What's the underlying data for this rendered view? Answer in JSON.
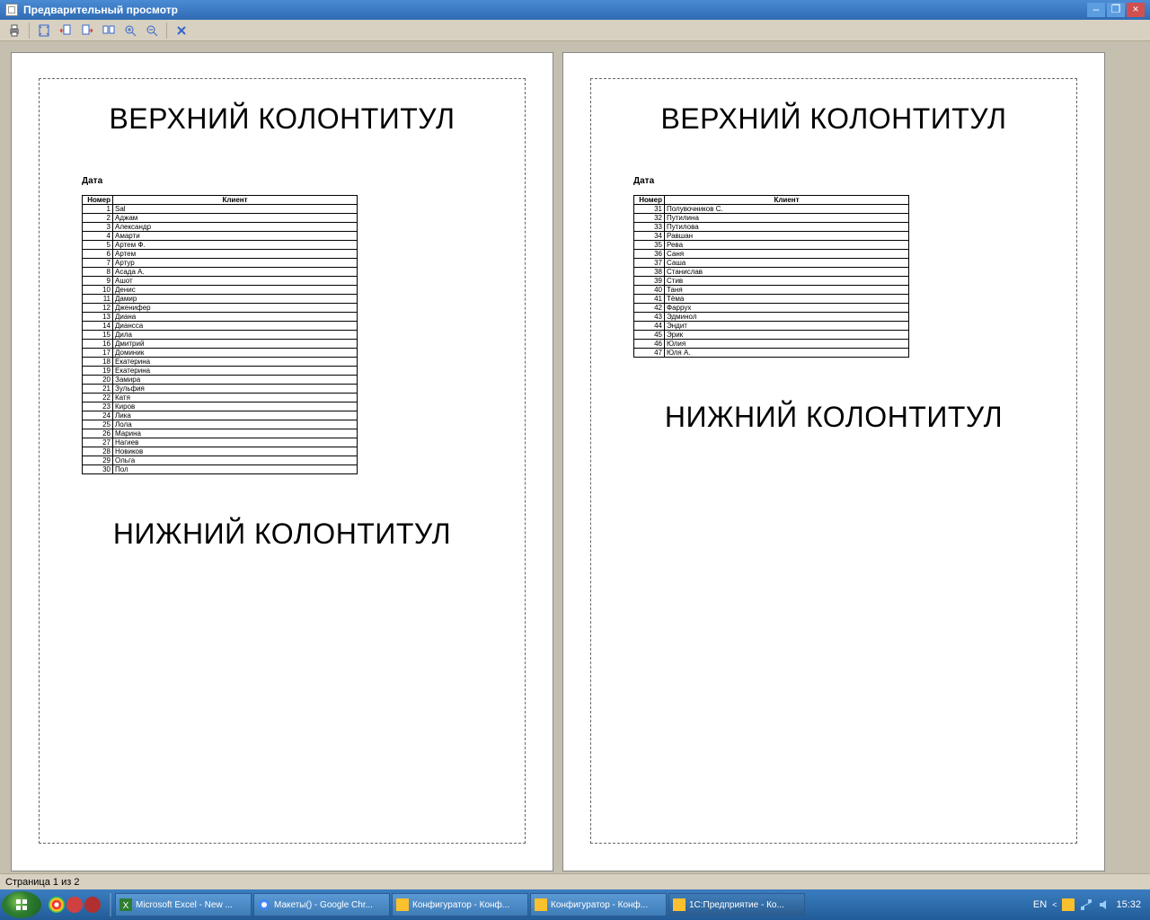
{
  "window_title": "Предварительный просмотр",
  "header_text": "ВЕРХНИЙ КОЛОНТИТУЛ",
  "footer_text": "НИЖНИЙ КОЛОНТИТУЛ",
  "date_label": "Дата",
  "table_headers": {
    "num": "Номер",
    "client": "Клиент"
  },
  "page1_rows": [
    [
      1,
      "Sal"
    ],
    [
      2,
      "Аджам"
    ],
    [
      3,
      "Александр"
    ],
    [
      4,
      "Амарти"
    ],
    [
      5,
      "Артем Ф."
    ],
    [
      6,
      "Артем"
    ],
    [
      7,
      "Артур"
    ],
    [
      8,
      "Асада А."
    ],
    [
      9,
      "Ашот"
    ],
    [
      10,
      "Денис"
    ],
    [
      11,
      "Дамир"
    ],
    [
      12,
      "Дженифер"
    ],
    [
      13,
      "Диана"
    ],
    [
      14,
      "Диансса"
    ],
    [
      15,
      "Дила"
    ],
    [
      16,
      "Дмитрий"
    ],
    [
      17,
      "Доминик"
    ],
    [
      18,
      "Екатерина"
    ],
    [
      19,
      "Екатерина"
    ],
    [
      20,
      "Замира"
    ],
    [
      21,
      "Зульфия"
    ],
    [
      22,
      "Катя"
    ],
    [
      23,
      "Киров"
    ],
    [
      24,
      "Лика"
    ],
    [
      25,
      "Лола"
    ],
    [
      26,
      "Марина"
    ],
    [
      27,
      "Нагиев"
    ],
    [
      28,
      "Новиков"
    ],
    [
      29,
      "Ольга"
    ],
    [
      30,
      "Пол"
    ]
  ],
  "page2_rows": [
    [
      31,
      "Полувочников С."
    ],
    [
      32,
      "Путилина"
    ],
    [
      33,
      "Путилова"
    ],
    [
      34,
      "Равшан"
    ],
    [
      35,
      "Рева"
    ],
    [
      36,
      "Саня"
    ],
    [
      37,
      "Саша"
    ],
    [
      38,
      "Станислав"
    ],
    [
      39,
      "Стив"
    ],
    [
      40,
      "Таня"
    ],
    [
      41,
      "Тёма"
    ],
    [
      42,
      "Фаррух"
    ],
    [
      43,
      "Эдминол"
    ],
    [
      44,
      "Эндит"
    ],
    [
      45,
      "Эрик"
    ],
    [
      46,
      "Юлия"
    ],
    [
      47,
      "Юля А."
    ]
  ],
  "status_text": "Страница 1 из 2",
  "taskbar": {
    "items": [
      "Microsoft Excel - New ...",
      "Макеты() - Google Chr...",
      "Конфигуратор - Конф...",
      "Конфигуратор - Конф...",
      "1С:Предприятие - Ко..."
    ],
    "lang": "EN",
    "time": "15:32"
  }
}
